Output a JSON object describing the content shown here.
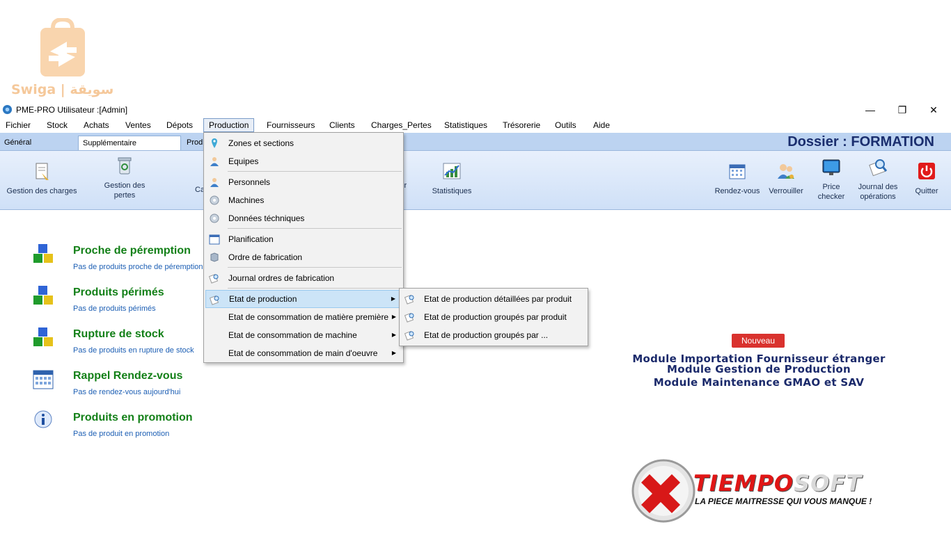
{
  "watermark": {
    "text": "Swiga | سويقة"
  },
  "window": {
    "title": "PME-PRO  Utilisateur :[Admin]",
    "minimize": "—",
    "restore": "❐",
    "close": "✕"
  },
  "menubar": [
    {
      "label": "Fichier"
    },
    {
      "label": "Stock"
    },
    {
      "label": "Achats"
    },
    {
      "label": "Ventes"
    },
    {
      "label": "Dépots"
    },
    {
      "label": "Production"
    },
    {
      "label": "Fournisseurs"
    },
    {
      "label": "Clients"
    },
    {
      "label": "Charges_Pertes"
    },
    {
      "label": "Statistiques"
    },
    {
      "label": "Trésorerie"
    },
    {
      "label": "Outils"
    },
    {
      "label": "Aide"
    }
  ],
  "tabs": [
    "Général",
    "Supplémentaire",
    "Prod"
  ],
  "dossier": "Dossier : FORMATION",
  "ribbon": {
    "charges": "Gestion des charges",
    "pertes_1": "Gestion des",
    "pertes_2": "pertes",
    "partial_ca": "Ca",
    "partial_ir": "ir",
    "statistiques": "Statistiques",
    "rendezvous": "Rendez-vous",
    "verrouiller": "Verrouiller",
    "price_1": "Price",
    "price_2": "checker",
    "journal_1": "Journal des",
    "journal_2": "opérations",
    "quitter": "Quitter"
  },
  "dashboard": [
    {
      "title": "Proche de péremption",
      "sub": "Pas de produits proche de péremption"
    },
    {
      "title": "Produits périmés",
      "sub": "Pas de produits périmés"
    },
    {
      "title": "Rupture de stock",
      "sub": "Pas de produits en rupture de stock"
    },
    {
      "title": "Rappel Rendez-vous",
      "sub": "Pas de rendez-vous aujourd'hui"
    },
    {
      "title": "Produits en promotion",
      "sub": "Pas de produit en promotion"
    }
  ],
  "production_menu": {
    "zones": "Zones et sections",
    "equipes": "Equipes",
    "personnels": "Personnels",
    "machines": "Machines",
    "donnees": "Données téchniques",
    "planification": "Planification",
    "ordre": "Ordre de fabrication",
    "journal": "Journal ordres de fabrication",
    "etat_production": "Etat de production",
    "etat_matiere": "Etat de consommation de matière première",
    "etat_machine": "Etat de consommation de machine",
    "etat_main": "Etat de consommation de main d'oeuvre"
  },
  "submenu": {
    "detaillees": "Etat de production détaillées par produit",
    "groupes_produit": "Etat de production groupés par produit",
    "groupes_par": "Etat de production groupés par ..."
  },
  "promo": {
    "badge": "Nouveau",
    "line1": "Module Importation Fournisseur étranger",
    "line2": "Module Gestion de Production",
    "line3": "Module Maintenance GMAO et SAV"
  },
  "brand": {
    "name_red": "TIEMPO",
    "name_grey": "SOFT",
    "tagline": "LA PIECE MAITRESSE QUI VOUS MANQUE !"
  },
  "colors": {
    "ribbon_bg": "#cfe0f7",
    "tabstrip_bg": "#bcd3f1",
    "dashboard_title": "#138018",
    "dashboard_sub": "#1d5fb4",
    "dossier": "#1a2e6e",
    "menu_highlight": "#cce4f7"
  }
}
